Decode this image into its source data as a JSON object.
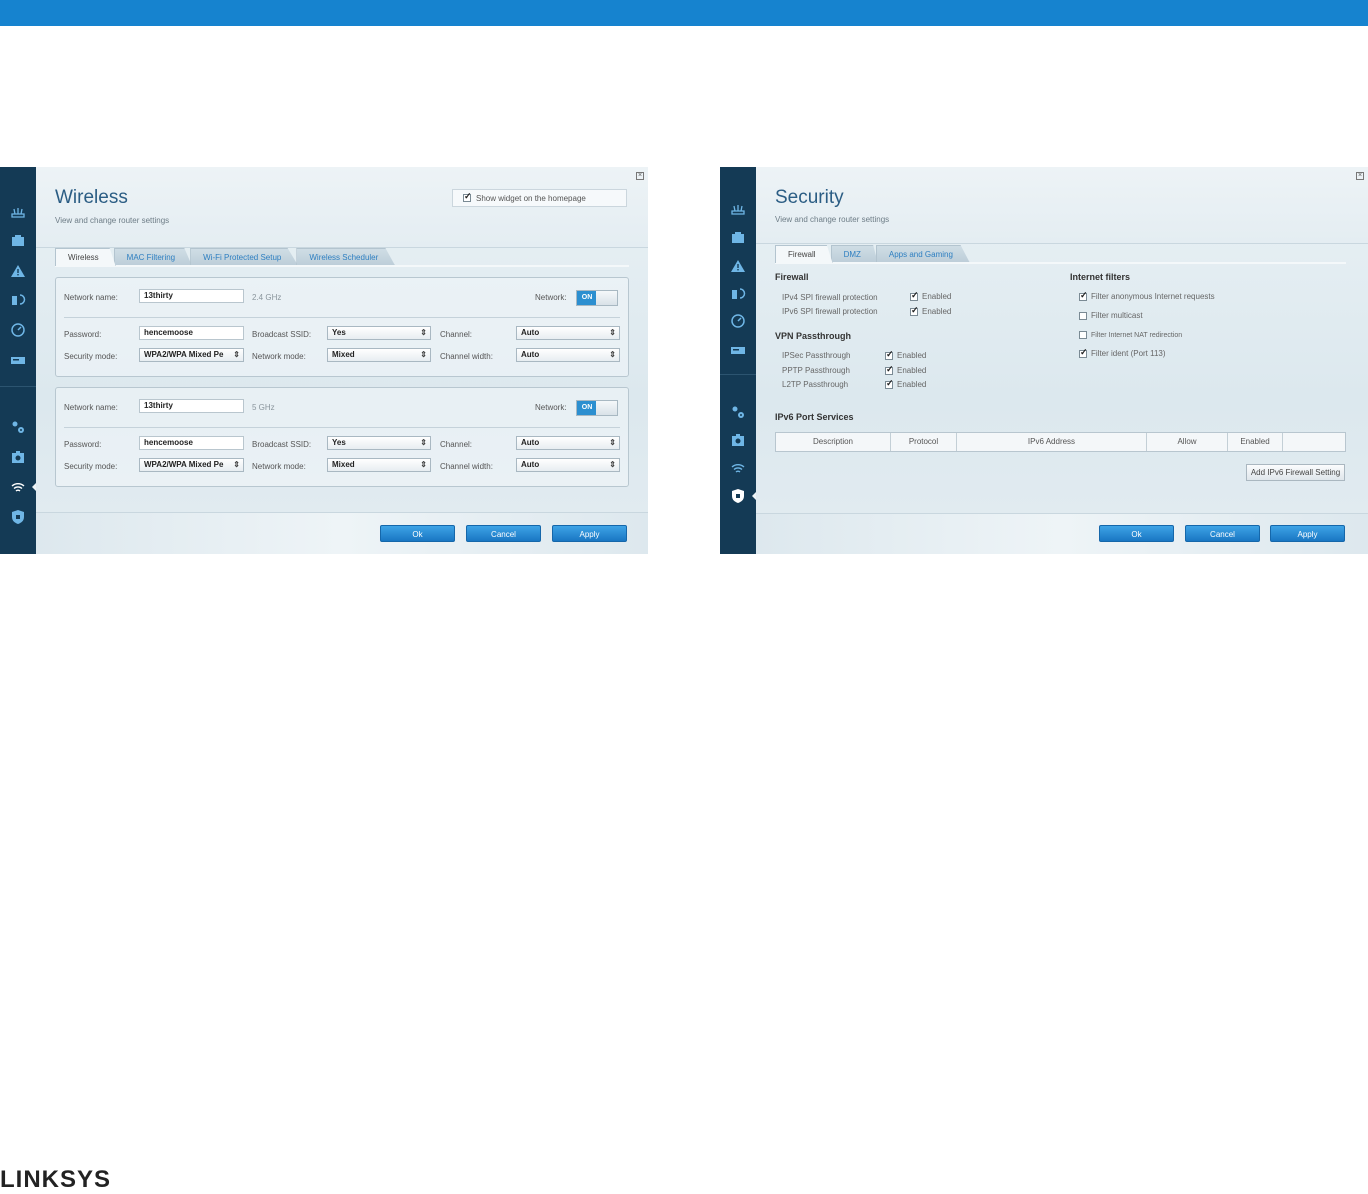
{
  "brand": "LINKSYS",
  "colors": {
    "topbar": "#1683cf",
    "sidebar": "#143a55",
    "accent": "#2b5d84",
    "button": "#1e88d4"
  },
  "wireless": {
    "title": "Wireless",
    "subtitle": "View and change router settings",
    "widget_label": "Show widget on the homepage",
    "tabs": [
      "Wireless",
      "MAC Filtering",
      "Wi-Fi Protected Setup",
      "Wireless Scheduler"
    ],
    "labels": {
      "network_name": "Network name:",
      "password": "Password:",
      "security_mode": "Security mode:",
      "broadcast_ssid": "Broadcast SSID:",
      "network_mode": "Network mode:",
      "channel": "Channel:",
      "channel_width": "Channel width:",
      "network": "Network:"
    },
    "bands": [
      {
        "freq": "2.4 GHz",
        "network_name": "13thirty",
        "password": "hencemoose",
        "security_mode": "WPA2/WPA Mixed Pe",
        "broadcast_ssid": "Yes",
        "network_mode": "Mixed",
        "channel": "Auto",
        "channel_width": "Auto",
        "network_state": "ON"
      },
      {
        "freq": "5 GHz",
        "network_name": "13thirty",
        "password": "hencemoose",
        "security_mode": "WPA2/WPA Mixed Pe",
        "broadcast_ssid": "Yes",
        "network_mode": "Mixed",
        "channel": "Auto",
        "channel_width": "Auto",
        "network_state": "ON"
      }
    ],
    "buttons": {
      "ok": "Ok",
      "cancel": "Cancel",
      "apply": "Apply"
    }
  },
  "security": {
    "title": "Security",
    "subtitle": "View and change router settings",
    "tabs": [
      "Firewall",
      "DMZ",
      "Apps and Gaming"
    ],
    "firewall": {
      "heading": "Firewall",
      "items": [
        {
          "label": "IPv4 SPI firewall protection",
          "state": "Enabled"
        },
        {
          "label": "IPv6 SPI firewall protection",
          "state": "Enabled"
        }
      ]
    },
    "vpn": {
      "heading": "VPN Passthrough",
      "items": [
        {
          "label": "IPSec Passthrough",
          "state": "Enabled"
        },
        {
          "label": "PPTP Passthrough",
          "state": "Enabled"
        },
        {
          "label": "L2TP Passthrough",
          "state": "Enabled"
        }
      ]
    },
    "internet_filters": {
      "heading": "Internet filters",
      "items": [
        {
          "label": "Filter anonymous Internet requests",
          "checked": true
        },
        {
          "label": "Filter multicast",
          "checked": false
        },
        {
          "label": "Filter Internet NAT redirection",
          "checked": false
        },
        {
          "label": "Filter ident (Port 113)",
          "checked": true
        }
      ]
    },
    "ipv6": {
      "heading": "IPv6 Port Services",
      "columns": [
        "Description",
        "Protocol",
        "IPv6 Address",
        "Allow",
        "Enabled",
        ""
      ],
      "add_button": "Add IPv6 Firewall Setting"
    },
    "buttons": {
      "ok": "Ok",
      "cancel": "Cancel",
      "apply": "Apply"
    }
  }
}
